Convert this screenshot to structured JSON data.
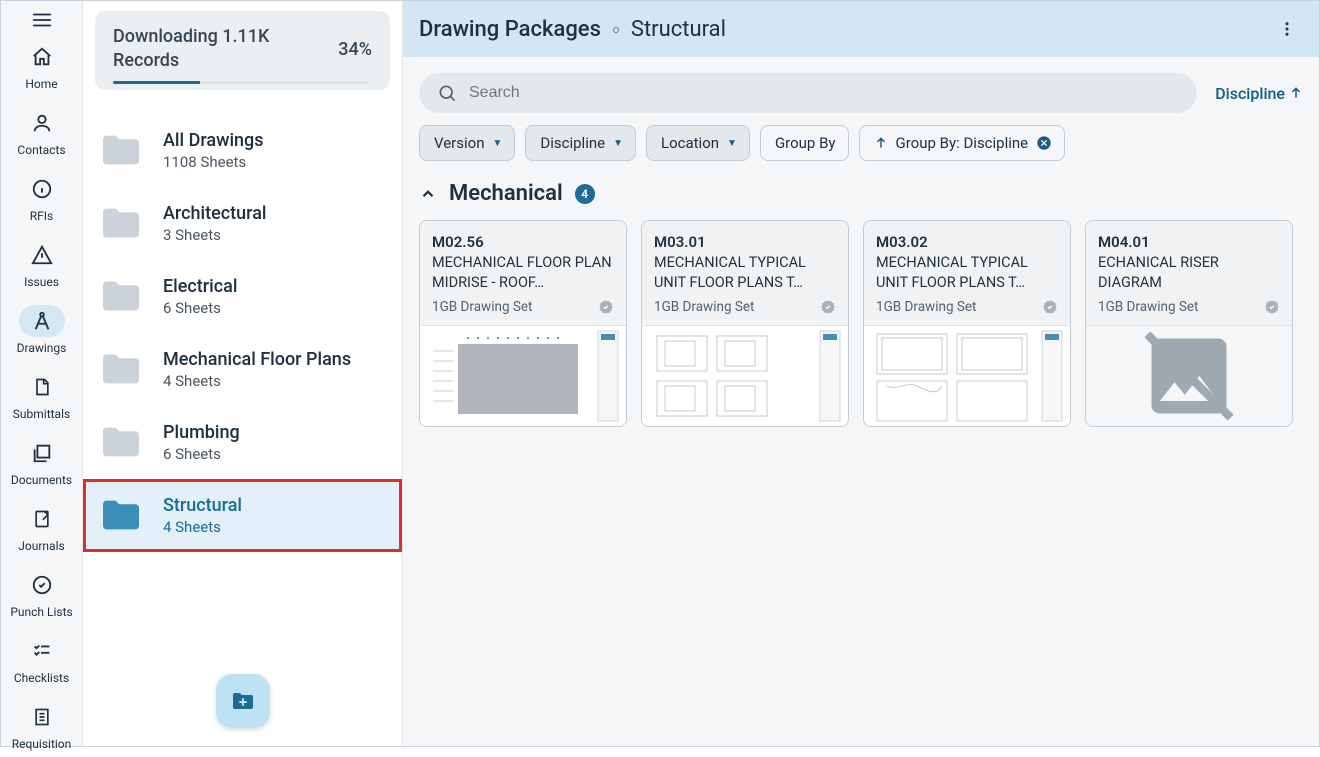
{
  "rail": {
    "items": [
      {
        "label": "Home"
      },
      {
        "label": "Contacts"
      },
      {
        "label": "RFIs"
      },
      {
        "label": "Issues"
      },
      {
        "label": "Drawings"
      },
      {
        "label": "Submittals"
      },
      {
        "label": "Documents"
      },
      {
        "label": "Journals"
      },
      {
        "label": "Punch Lists"
      },
      {
        "label": "Checklists"
      },
      {
        "label": "Requisition"
      }
    ]
  },
  "download": {
    "text": "Downloading 1.11K Records",
    "percent_label": "34%",
    "percent": 34
  },
  "folders": [
    {
      "title": "All Drawings",
      "sub": "1108 Sheets"
    },
    {
      "title": "Architectural",
      "sub": "3 Sheets"
    },
    {
      "title": "Electrical",
      "sub": "6 Sheets"
    },
    {
      "title": "Mechanical Floor Plans",
      "sub": "4 Sheets"
    },
    {
      "title": "Plumbing",
      "sub": "6 Sheets"
    },
    {
      "title": "Structural",
      "sub": "4 Sheets"
    }
  ],
  "header": {
    "root": "Drawing Packages",
    "leaf": "Structural"
  },
  "search": {
    "placeholder": "Search"
  },
  "sort": {
    "label": "Discipline"
  },
  "chips": {
    "version": "Version",
    "discipline": "Discipline",
    "location": "Location",
    "group_by": "Group By",
    "group_by_discipline": "Group By: Discipline"
  },
  "group": {
    "name": "Mechanical",
    "count": "4"
  },
  "cards": [
    {
      "code": "M02.56",
      "title": "MECHANICAL FLOOR PLAN MIDRISE - ROOF…",
      "set": "1GB Drawing Set"
    },
    {
      "code": "M03.01",
      "title": "MECHANICAL TYPICAL UNIT FLOOR PLANS T…",
      "set": "1GB Drawing Set"
    },
    {
      "code": "M03.02",
      "title": "MECHANICAL TYPICAL UNIT FLOOR PLANS T…",
      "set": "1GB Drawing Set"
    },
    {
      "code": "M04.01",
      "title": "ECHANICAL RISER DIAGRAM",
      "set": "1GB Drawing Set"
    }
  ]
}
